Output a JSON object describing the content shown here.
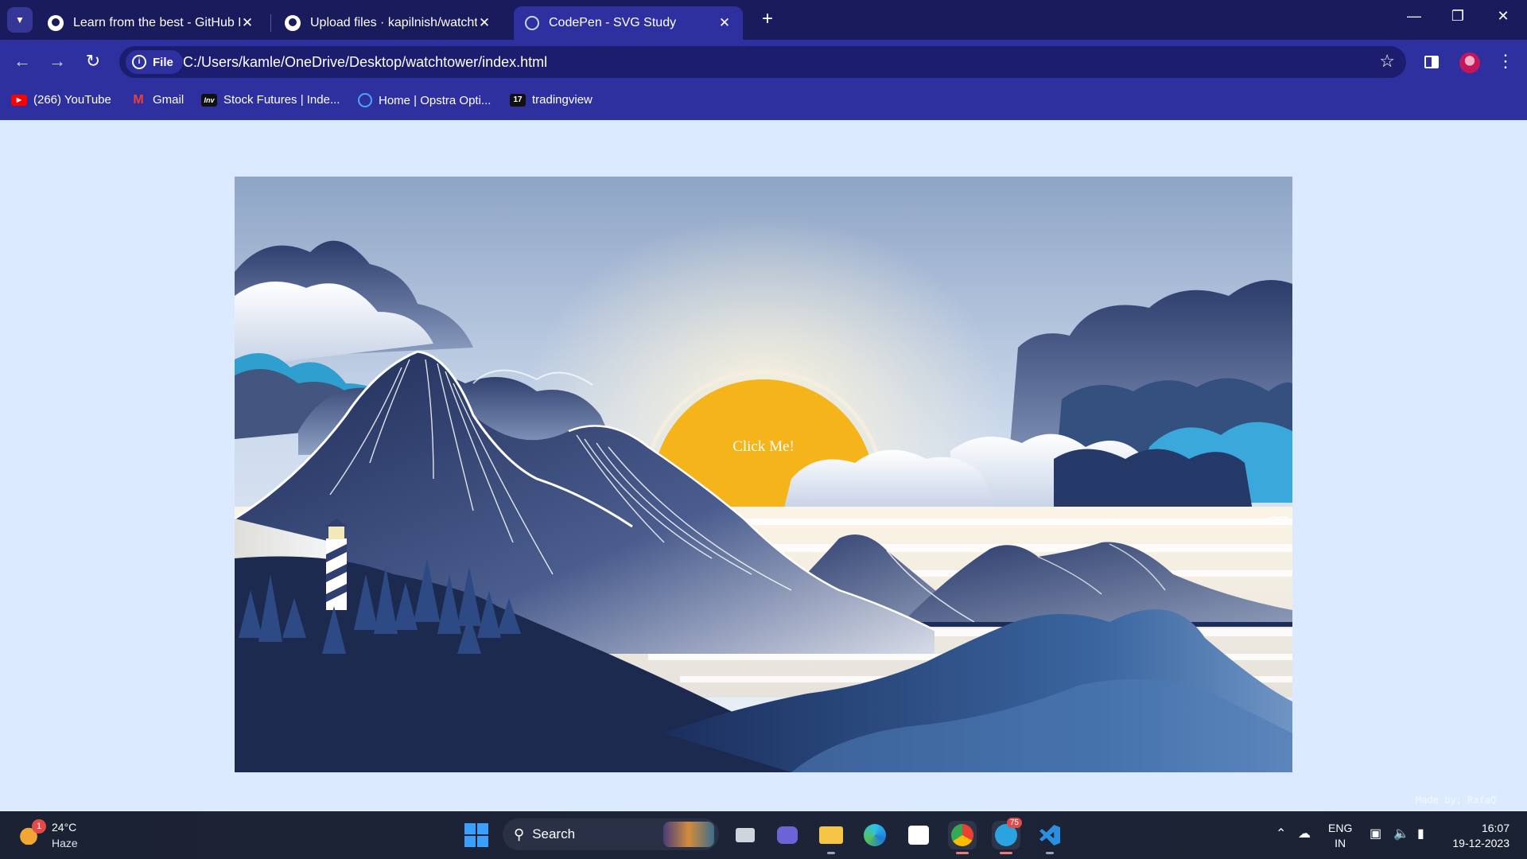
{
  "browser": {
    "tabs": [
      {
        "title": "Learn from the best - GitHub Re",
        "icon": "github-icon",
        "active": false
      },
      {
        "title": "Upload files · kapilnish/watchtow",
        "icon": "github-icon",
        "active": false
      },
      {
        "title": "CodePen - SVG Study",
        "icon": "globe-icon",
        "active": true
      }
    ],
    "address": {
      "chip_label": "File",
      "url": "C:/Users/kamle/OneDrive/Desktop/watchtower/index.html"
    },
    "bookmarks": [
      {
        "label": "(266) YouTube",
        "icon": "youtube-icon"
      },
      {
        "label": "Gmail",
        "icon": "gmail-icon"
      },
      {
        "label": "Stock Futures | Inde...",
        "icon": "investing-icon"
      },
      {
        "label": "Home | Opstra Opti...",
        "icon": "opstra-icon"
      },
      {
        "label": "tradingview",
        "icon": "tradingview-icon"
      }
    ]
  },
  "page": {
    "sun_button_label": "Click Me!",
    "credit": "Made by: RafaQ",
    "colors": {
      "page_bg": "#dbeafe",
      "sun": "#f4b41a",
      "navy": "#1b2a4e"
    }
  },
  "taskbar": {
    "weather": {
      "temp": "24°C",
      "desc": "Haze",
      "badge": "1"
    },
    "search_label": "Search",
    "language": {
      "line1": "ENG",
      "line2": "IN"
    },
    "clock": {
      "time": "16:07",
      "date": "19-12-2023"
    },
    "telegram_badge": "75"
  }
}
